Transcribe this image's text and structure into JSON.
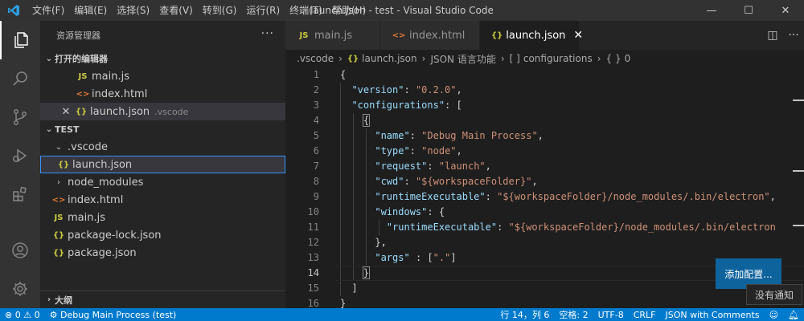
{
  "window": {
    "title": "launch.json - test - Visual Studio Code",
    "menu": [
      "文件(F)",
      "编辑(E)",
      "选择(S)",
      "查看(V)",
      "转到(G)",
      "运行(R)",
      "终端(T)",
      "帮助(H)"
    ],
    "controls": {
      "minimize": "—",
      "maximize": "☐",
      "close": "✕"
    }
  },
  "colors": {
    "accent": "#007acc",
    "button": "#0e639c",
    "string": "#ce9178",
    "key": "#9cdcfe"
  },
  "sidebar": {
    "title": "资源管理器",
    "more": "···",
    "open_editors": {
      "label": "打开的编辑器",
      "items": [
        {
          "icon": "JS",
          "name": "main.js",
          "desc": ""
        },
        {
          "icon": "<>",
          "name": "index.html",
          "desc": ""
        },
        {
          "icon": "{}",
          "name": "launch.json",
          "desc": ".vscode"
        }
      ]
    },
    "workspace": {
      "label": "TEST",
      "items": [
        {
          "icon": "",
          "name": ".vscode",
          "chev": "⌄"
        },
        {
          "icon": "{}",
          "name": "launch.json"
        },
        {
          "icon": "",
          "name": "node_modules",
          "chev": "›"
        },
        {
          "icon": "<>",
          "name": "index.html"
        },
        {
          "icon": "JS",
          "name": "main.js"
        },
        {
          "icon": "{}",
          "name": "package-lock.json"
        },
        {
          "icon": "{}",
          "name": "package.json"
        }
      ]
    },
    "outline_label": "大纲"
  },
  "tabs": [
    {
      "icon": "JS",
      "label": "main.js"
    },
    {
      "icon": "<>",
      "label": "index.html"
    },
    {
      "icon": "{}",
      "label": "launch.json",
      "close": "✕"
    }
  ],
  "tab_actions": {
    "split": "◫",
    "more": "···"
  },
  "breadcrumb": {
    "folder": ".vscode",
    "file": "launch.json",
    "lang": "JSON 语言功能",
    "arr": "configurations",
    "obj": "0",
    "sep": "›",
    "arr_icon": "[ ]",
    "obj_icon": "{ }",
    "file_icon": "{}"
  },
  "code": {
    "line_numbers": [
      "1",
      "2",
      "3",
      "4",
      "5",
      "6",
      "7",
      "8",
      "9",
      "10",
      "11",
      "12",
      "13",
      "14",
      "15",
      "16"
    ],
    "current_line": "14",
    "tokens": {
      "l1": "{",
      "version_key": "\"version\"",
      "version_val": "\"0.2.0\"",
      "configurations_key": "\"configurations\"",
      "open_arr": "[",
      "open_obj": "{",
      "name_key": "\"name\"",
      "name_val": "\"Debug Main Process\"",
      "type_key": "\"type\"",
      "type_val": "\"node\"",
      "request_key": "\"request\"",
      "request_val": "\"launch\"",
      "cwd_key": "\"cwd\"",
      "cwd_val": "\"${workspaceFolder}\"",
      "runtime_key": "\"runtimeExecutable\"",
      "runtime_val": "\"${workspaceFolder}/node_modules/.bin/electron\"",
      "windows_key": "\"windows\"",
      "runtime2_key": "\"runtimeExecutable\"",
      "runtime2_val": "\"${workspaceFolder}/node_modules/.bin/electron",
      "close_obj_comma": "},",
      "args_key": "\"args\"",
      "args_val": "\".\"",
      "close_obj": "}",
      "close_arr": "]",
      "close_root": "}"
    }
  },
  "notifications": {
    "add_config": "添加配置...",
    "tooltip": "没有通知"
  },
  "statusbar": {
    "errors": "0",
    "warnings": "0",
    "debug": "Debug Main Process (test)",
    "position": "行 14，列 6",
    "spaces": "空格: 2",
    "encoding": "UTF-8",
    "eol": "CRLF",
    "language": "JSON with Comments"
  }
}
